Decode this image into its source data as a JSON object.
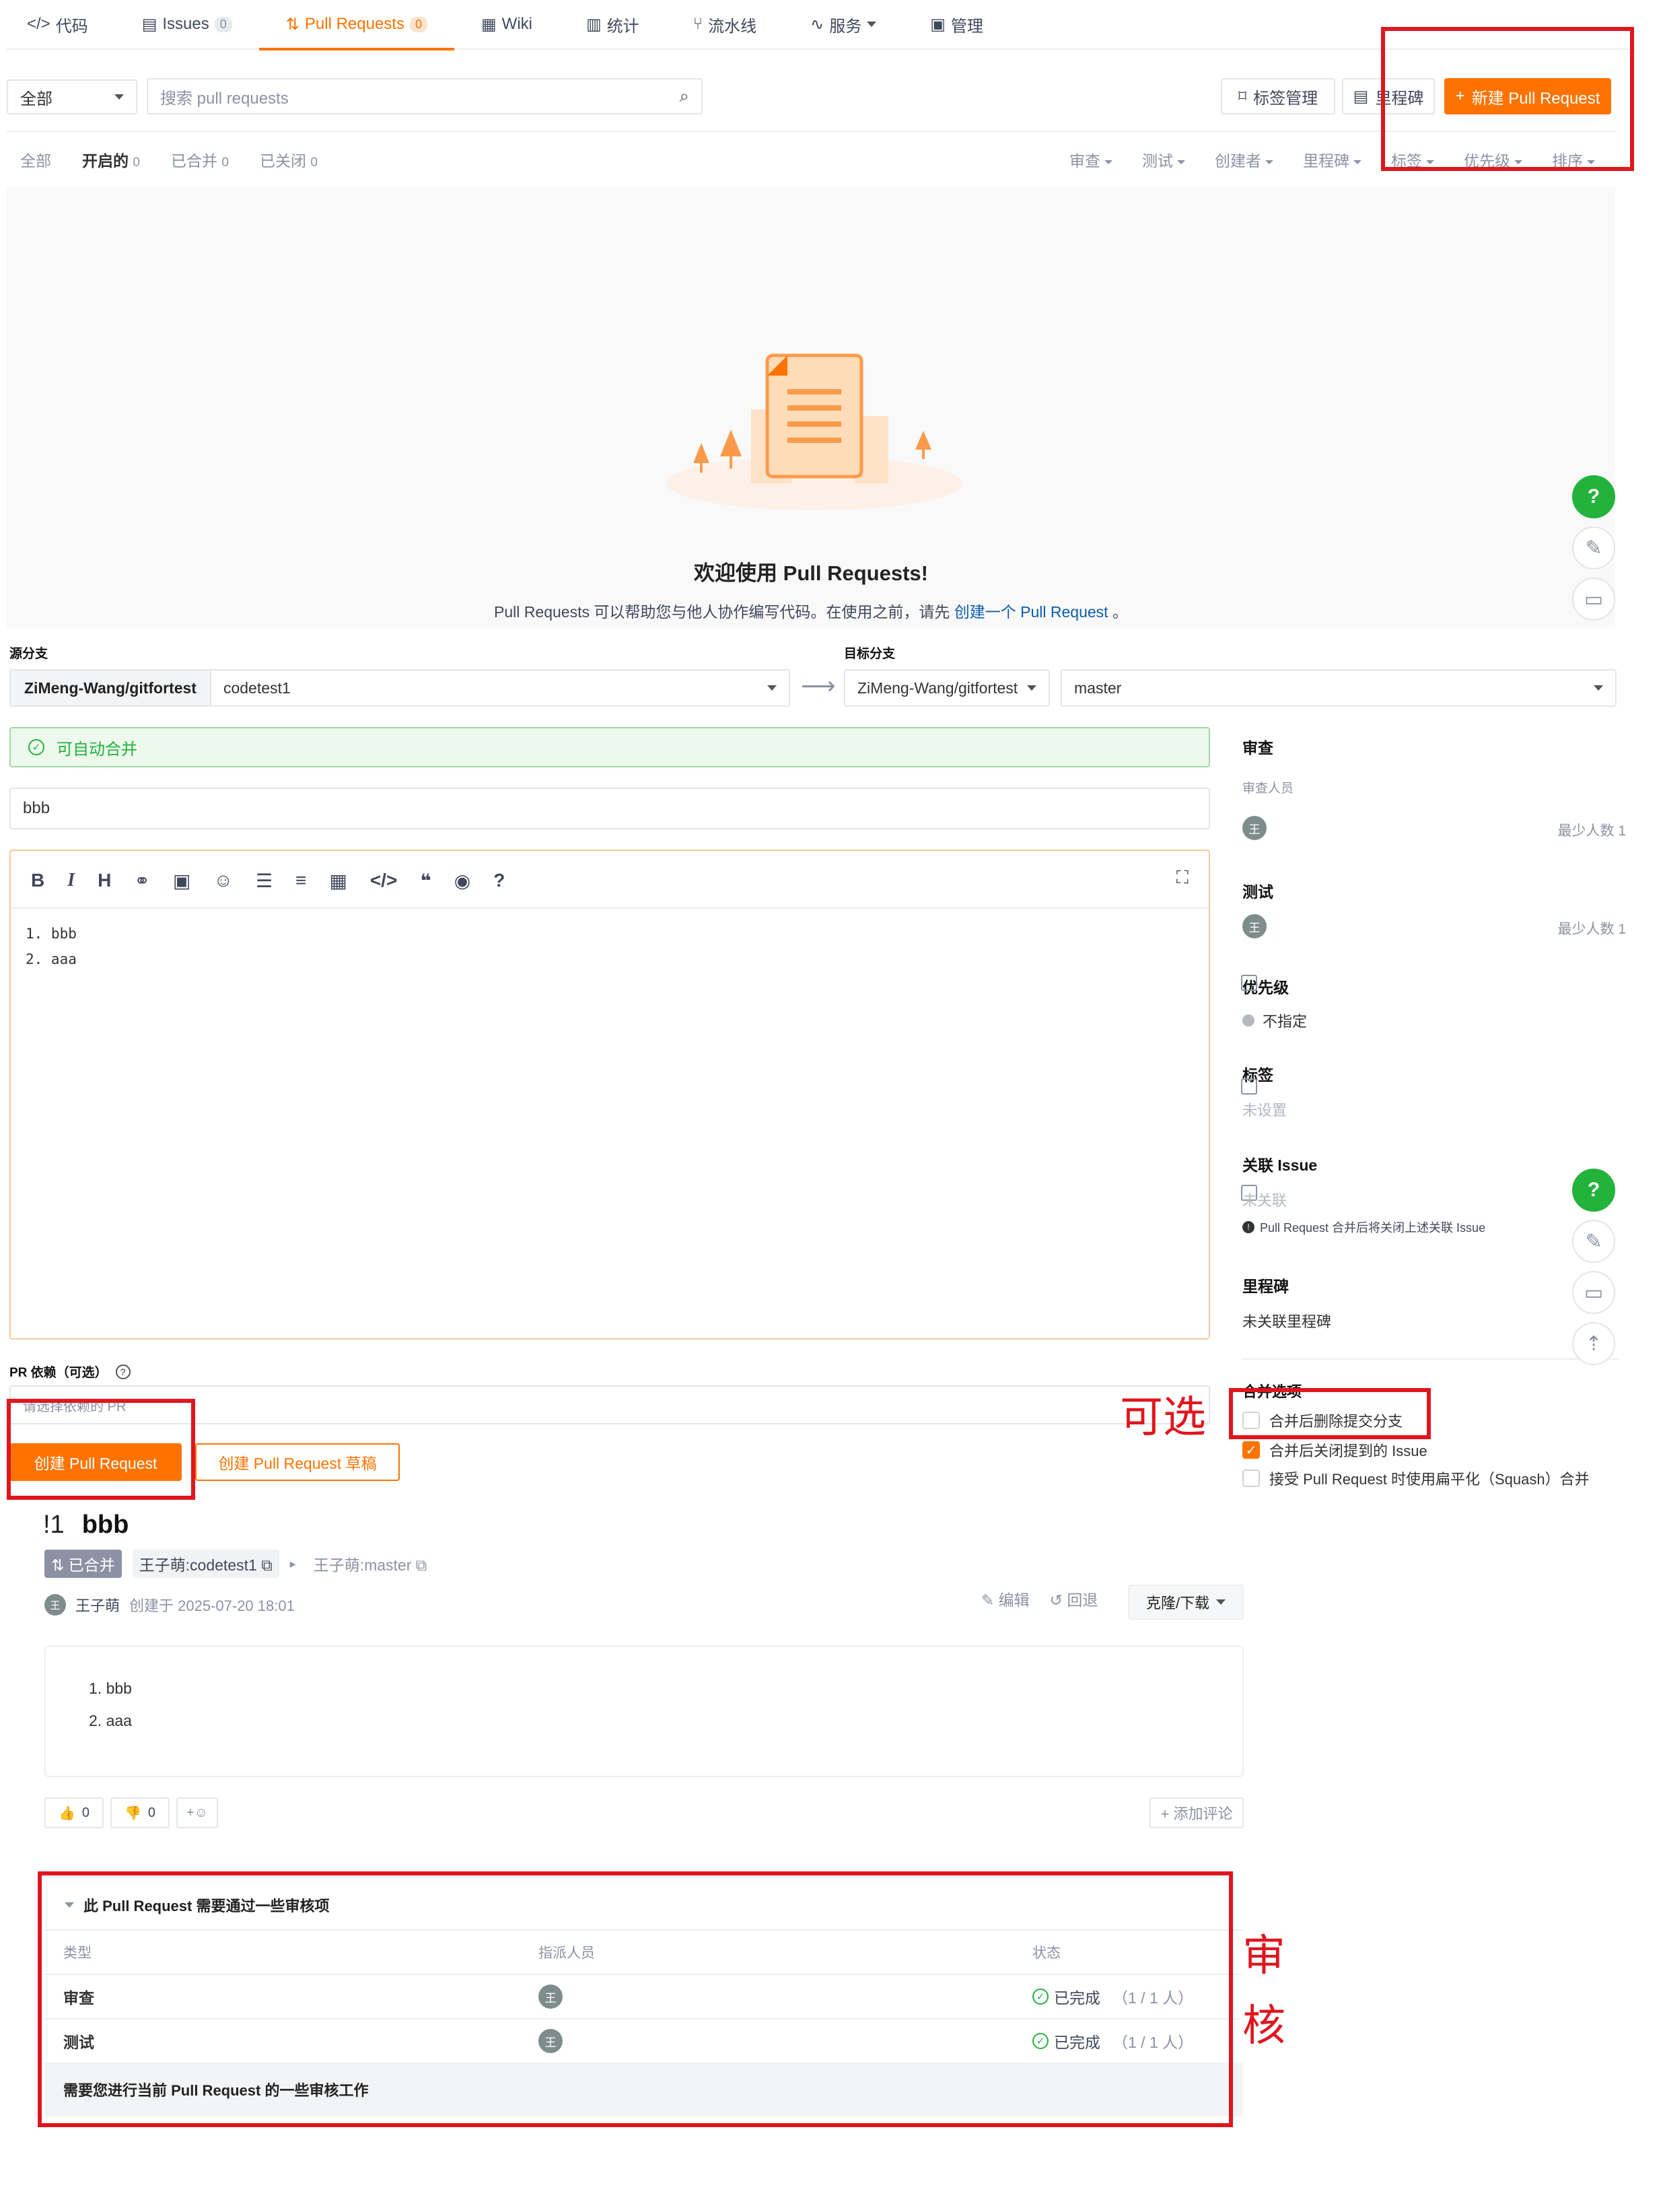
{
  "nav": {
    "tabs": [
      {
        "icon": "code-icon",
        "label": "代码"
      },
      {
        "icon": "issues-icon",
        "label": "Issues",
        "count": "0"
      },
      {
        "icon": "pull-request-icon",
        "label": "Pull Requests",
        "count": "0"
      },
      {
        "icon": "wiki-icon",
        "label": "Wiki"
      },
      {
        "icon": "stats-icon",
        "label": "统计"
      },
      {
        "icon": "pipeline-icon",
        "label": "流水线"
      },
      {
        "icon": "service-icon",
        "label": "服务"
      },
      {
        "icon": "manage-icon",
        "label": "管理"
      }
    ]
  },
  "toolbar": {
    "scope_value": "全部",
    "search_placeholder": "搜索 pull requests",
    "labels_button": "标签管理",
    "milestones_button": "里程碑",
    "new_pr_button": "新建 Pull Request"
  },
  "filters": {
    "states": [
      {
        "label": "全部"
      },
      {
        "label": "开启的",
        "count": "0"
      },
      {
        "label": "已合并",
        "count": "0"
      },
      {
        "label": "已关闭",
        "count": "0"
      }
    ],
    "dropdowns": [
      "审查",
      "测试",
      "创建者",
      "里程碑",
      "标签",
      "优先级",
      "排序"
    ]
  },
  "empty": {
    "title": "欢迎使用 Pull Requests!",
    "desc_prefix": "Pull Requests 可以帮助您与他人协作编写代码。在使用之前，请先",
    "desc_link": "创建一个 Pull Request",
    "desc_suffix": "。"
  },
  "create": {
    "source_label": "源分支",
    "source_repo": "ZiMeng-Wang/gitfortest",
    "source_branch": "codetest1",
    "target_label": "目标分支",
    "target_repo": "ZiMeng-Wang/gitfortest",
    "target_branch": "master",
    "merge_status": "可自动合并",
    "title_value": "bbb",
    "body_lines": [
      "1. bbb",
      "2. aaa"
    ],
    "dep_label": "PR 依赖（可选）",
    "dep_placeholder": "请选择依赖的 PR",
    "create_button": "创建 Pull Request",
    "draft_button": "创建 Pull Request 草稿"
  },
  "sidebar": {
    "review_title": "审查",
    "reviewers_label": "审查人员",
    "reviewer_avatar": "王",
    "reviewer_min": "最少人数 1",
    "test_title": "测试",
    "tester_avatar": "王",
    "tester_min": "最少人数 1",
    "priority_title": "优先级",
    "priority_value": "不指定",
    "labels_title": "标签",
    "labels_value": "未设置",
    "issue_title": "关联 Issue",
    "issue_value": "未关联",
    "issue_note": "Pull Request 合并后将关闭上述关联 Issue",
    "milestone_title": "里程碑",
    "milestone_value": "未关联里程碑",
    "merge_options_title": "合并选项",
    "options": [
      {
        "label": "合并后删除提交分支",
        "checked": false
      },
      {
        "label": "合并后关闭提到的 Issue",
        "checked": true
      },
      {
        "label": "接受 Pull Request 时使用扁平化（Squash）合并",
        "checked": false
      }
    ]
  },
  "annotations": {
    "optional": "可选",
    "review": [
      "审",
      "核"
    ]
  },
  "pr": {
    "number": "!1",
    "title": "bbb",
    "status": "已合并",
    "source": "王子萌:codetest1",
    "target": "王子萌:master",
    "author_avatar": "王",
    "author": "王子萌",
    "created": "创建于 2025-07-20 18:01",
    "edit": "编辑",
    "revert": "回退",
    "clone": "克隆/下载",
    "body_items": [
      "bbb",
      "aaa"
    ],
    "thumbs_up": "0",
    "thumbs_down": "0",
    "add_comment": "+ 添加评论",
    "review_section_title": "此 Pull Request 需要通过一些审核项",
    "columns": [
      "类型",
      "指派人员",
      "状态"
    ],
    "rows": [
      {
        "type": "审查",
        "avatar": "王",
        "status": "已完成",
        "progress": "（1 / 1 人）"
      },
      {
        "type": "测试",
        "avatar": "王",
        "status": "已完成",
        "progress": "（1 / 1 人）"
      }
    ],
    "footer_note": "需要您进行当前 Pull Request 的一些审核工作"
  },
  "colors": {
    "accent": "#fe7300",
    "success": "#23b33c",
    "annotation": "#e0161e"
  }
}
